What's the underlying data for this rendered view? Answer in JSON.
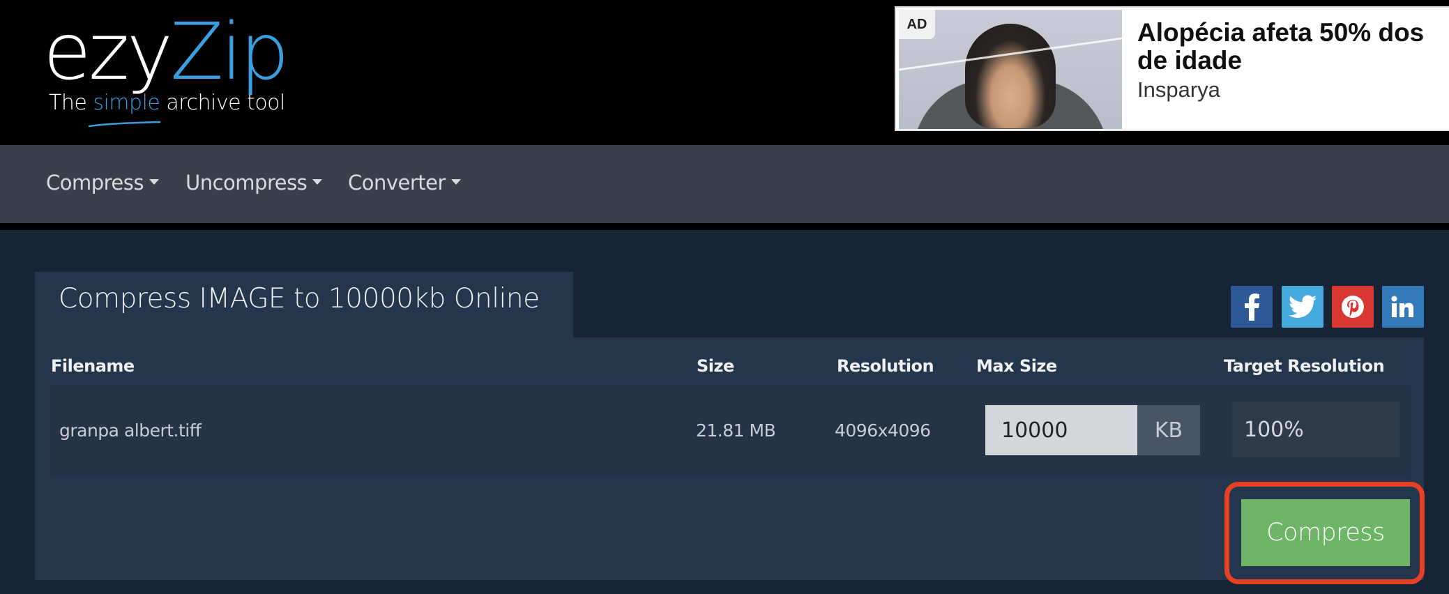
{
  "header": {
    "logo": {
      "part1": "ezy",
      "part2": "Zip",
      "tagline_before": "The ",
      "tagline_highlight": "simple",
      "tagline_after": " archive tool"
    },
    "ad": {
      "badge": "AD",
      "title_line1": "Alopécia afeta 50% dos",
      "title_line2": "de idade",
      "brand": "Insparya"
    }
  },
  "nav": {
    "items": [
      {
        "label": "Compress",
        "icon": "caret-down-icon"
      },
      {
        "label": "Uncompress",
        "icon": "caret-down-icon"
      },
      {
        "label": "Converter",
        "icon": "caret-down-icon"
      }
    ]
  },
  "main": {
    "title": "Compress IMAGE to 10000kb Online",
    "social": [
      {
        "name": "facebook",
        "glyph": "f",
        "color": "#2d5a96"
      },
      {
        "name": "twitter",
        "glyph": "twitter-bird",
        "color": "#47aade"
      },
      {
        "name": "pinterest",
        "glyph": "p",
        "color": "#d93732"
      },
      {
        "name": "linkedin",
        "glyph": "in",
        "color": "#327ab8"
      }
    ],
    "table": {
      "headers": [
        "Filename",
        "Size",
        "Resolution",
        "Max Size",
        "Target Resolution"
      ],
      "rows": [
        {
          "filename": "granpa albert.tiff",
          "size": "21.81 MB",
          "resolution": "4096x4096",
          "max_size": "10000",
          "max_size_unit": "KB",
          "target_resolution": "100%"
        }
      ]
    },
    "compress_button": "Compress"
  },
  "colors": {
    "accent_blue": "#3a9ee0",
    "button_green": "#6fb567",
    "highlight_red": "#e84025",
    "page_bg": "#172436",
    "panel_bg": "#24364b"
  }
}
